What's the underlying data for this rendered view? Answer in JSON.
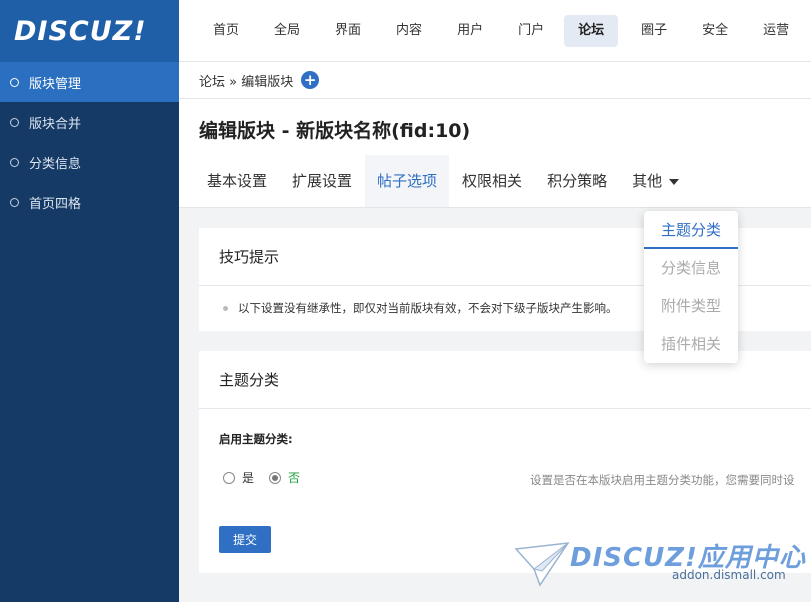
{
  "app": {
    "logo_text": "DISCUZ!"
  },
  "sidebar": {
    "items": [
      {
        "label": "版块管理",
        "active": true
      },
      {
        "label": "版块合并",
        "active": false
      },
      {
        "label": "分类信息",
        "active": false
      },
      {
        "label": "首页四格",
        "active": false
      }
    ]
  },
  "topnav": {
    "items": [
      "首页",
      "全局",
      "界面",
      "内容",
      "用户",
      "门户",
      "论坛",
      "圈子",
      "安全",
      "运营"
    ],
    "active": "论坛"
  },
  "breadcrumb": {
    "text": "论坛 » 编辑版块",
    "add_icon": "plus-icon"
  },
  "page": {
    "title": "编辑版块 - 新版块名称(fid:10)"
  },
  "tabs": {
    "items": [
      "基本设置",
      "扩展设置",
      "帖子选项",
      "权限相关",
      "积分策略",
      "其他"
    ],
    "active": "帖子选项"
  },
  "dropdown": {
    "items": [
      "主题分类",
      "分类信息",
      "附件类型",
      "插件相关"
    ],
    "active": "主题分类"
  },
  "tip_panel": {
    "title": "技巧提示",
    "text": "以下设置没有继承性，即仅对当前版块有效，不会对下级子版块产生影响。"
  },
  "topic_panel": {
    "title": "主题分类",
    "field_label": "启用主题分类:",
    "options": [
      {
        "label": "是",
        "checked": false
      },
      {
        "label": "否",
        "checked": true
      }
    ],
    "hint": "设置是否在本版块启用主题分类功能，您需要同时设",
    "submit_label": "提交"
  },
  "watermark": {
    "logo": "DISCUZ!应用中心",
    "url": "addon.dismall.com"
  },
  "colors": {
    "sidebar_bg": "#163a66",
    "accent": "#2f6fc4",
    "logo_bg": "#1f5fa8"
  }
}
